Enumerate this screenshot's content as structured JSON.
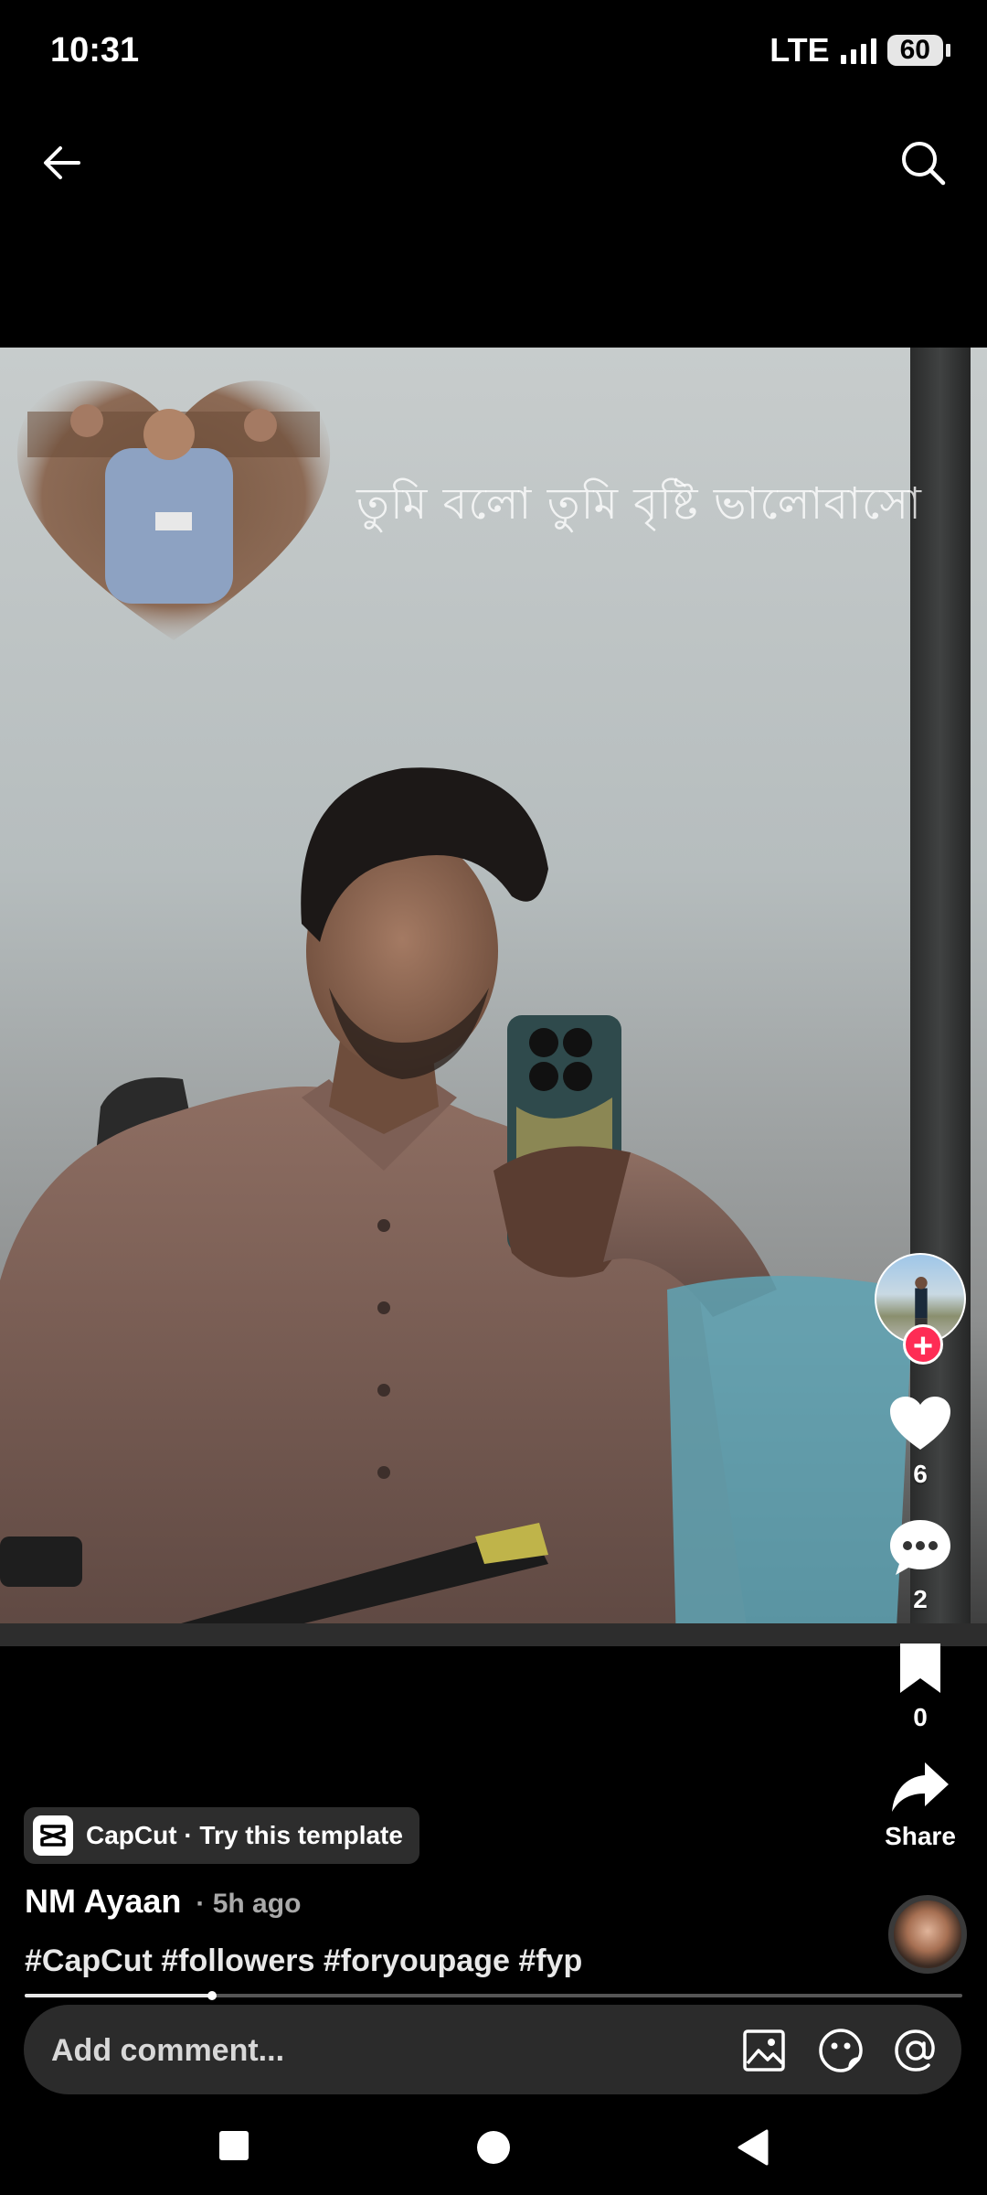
{
  "status_bar": {
    "time": "10:31",
    "network": "LTE",
    "battery": "60"
  },
  "top_bar": {
    "back_icon": "arrow-left-icon",
    "search_icon": "search-icon"
  },
  "video": {
    "overlay_text": "তুমি বলো তুমি বৃষ্টি ভালোবাসো"
  },
  "actions": {
    "likes": "6",
    "comments": "2",
    "saves": "0",
    "share_label": "Share"
  },
  "template_chip": {
    "label": "CapCut · Try this template"
  },
  "post": {
    "author": "NM Ayaan",
    "time": "· 5h ago",
    "caption": "#CapCut #followers #foryoupage #fyp",
    "progress": 0.2
  },
  "comment_bar": {
    "placeholder": "Add comment..."
  },
  "colors": {
    "accent": "#fe2c55",
    "background": "#000000",
    "input_bg": "#2b2b2b"
  }
}
